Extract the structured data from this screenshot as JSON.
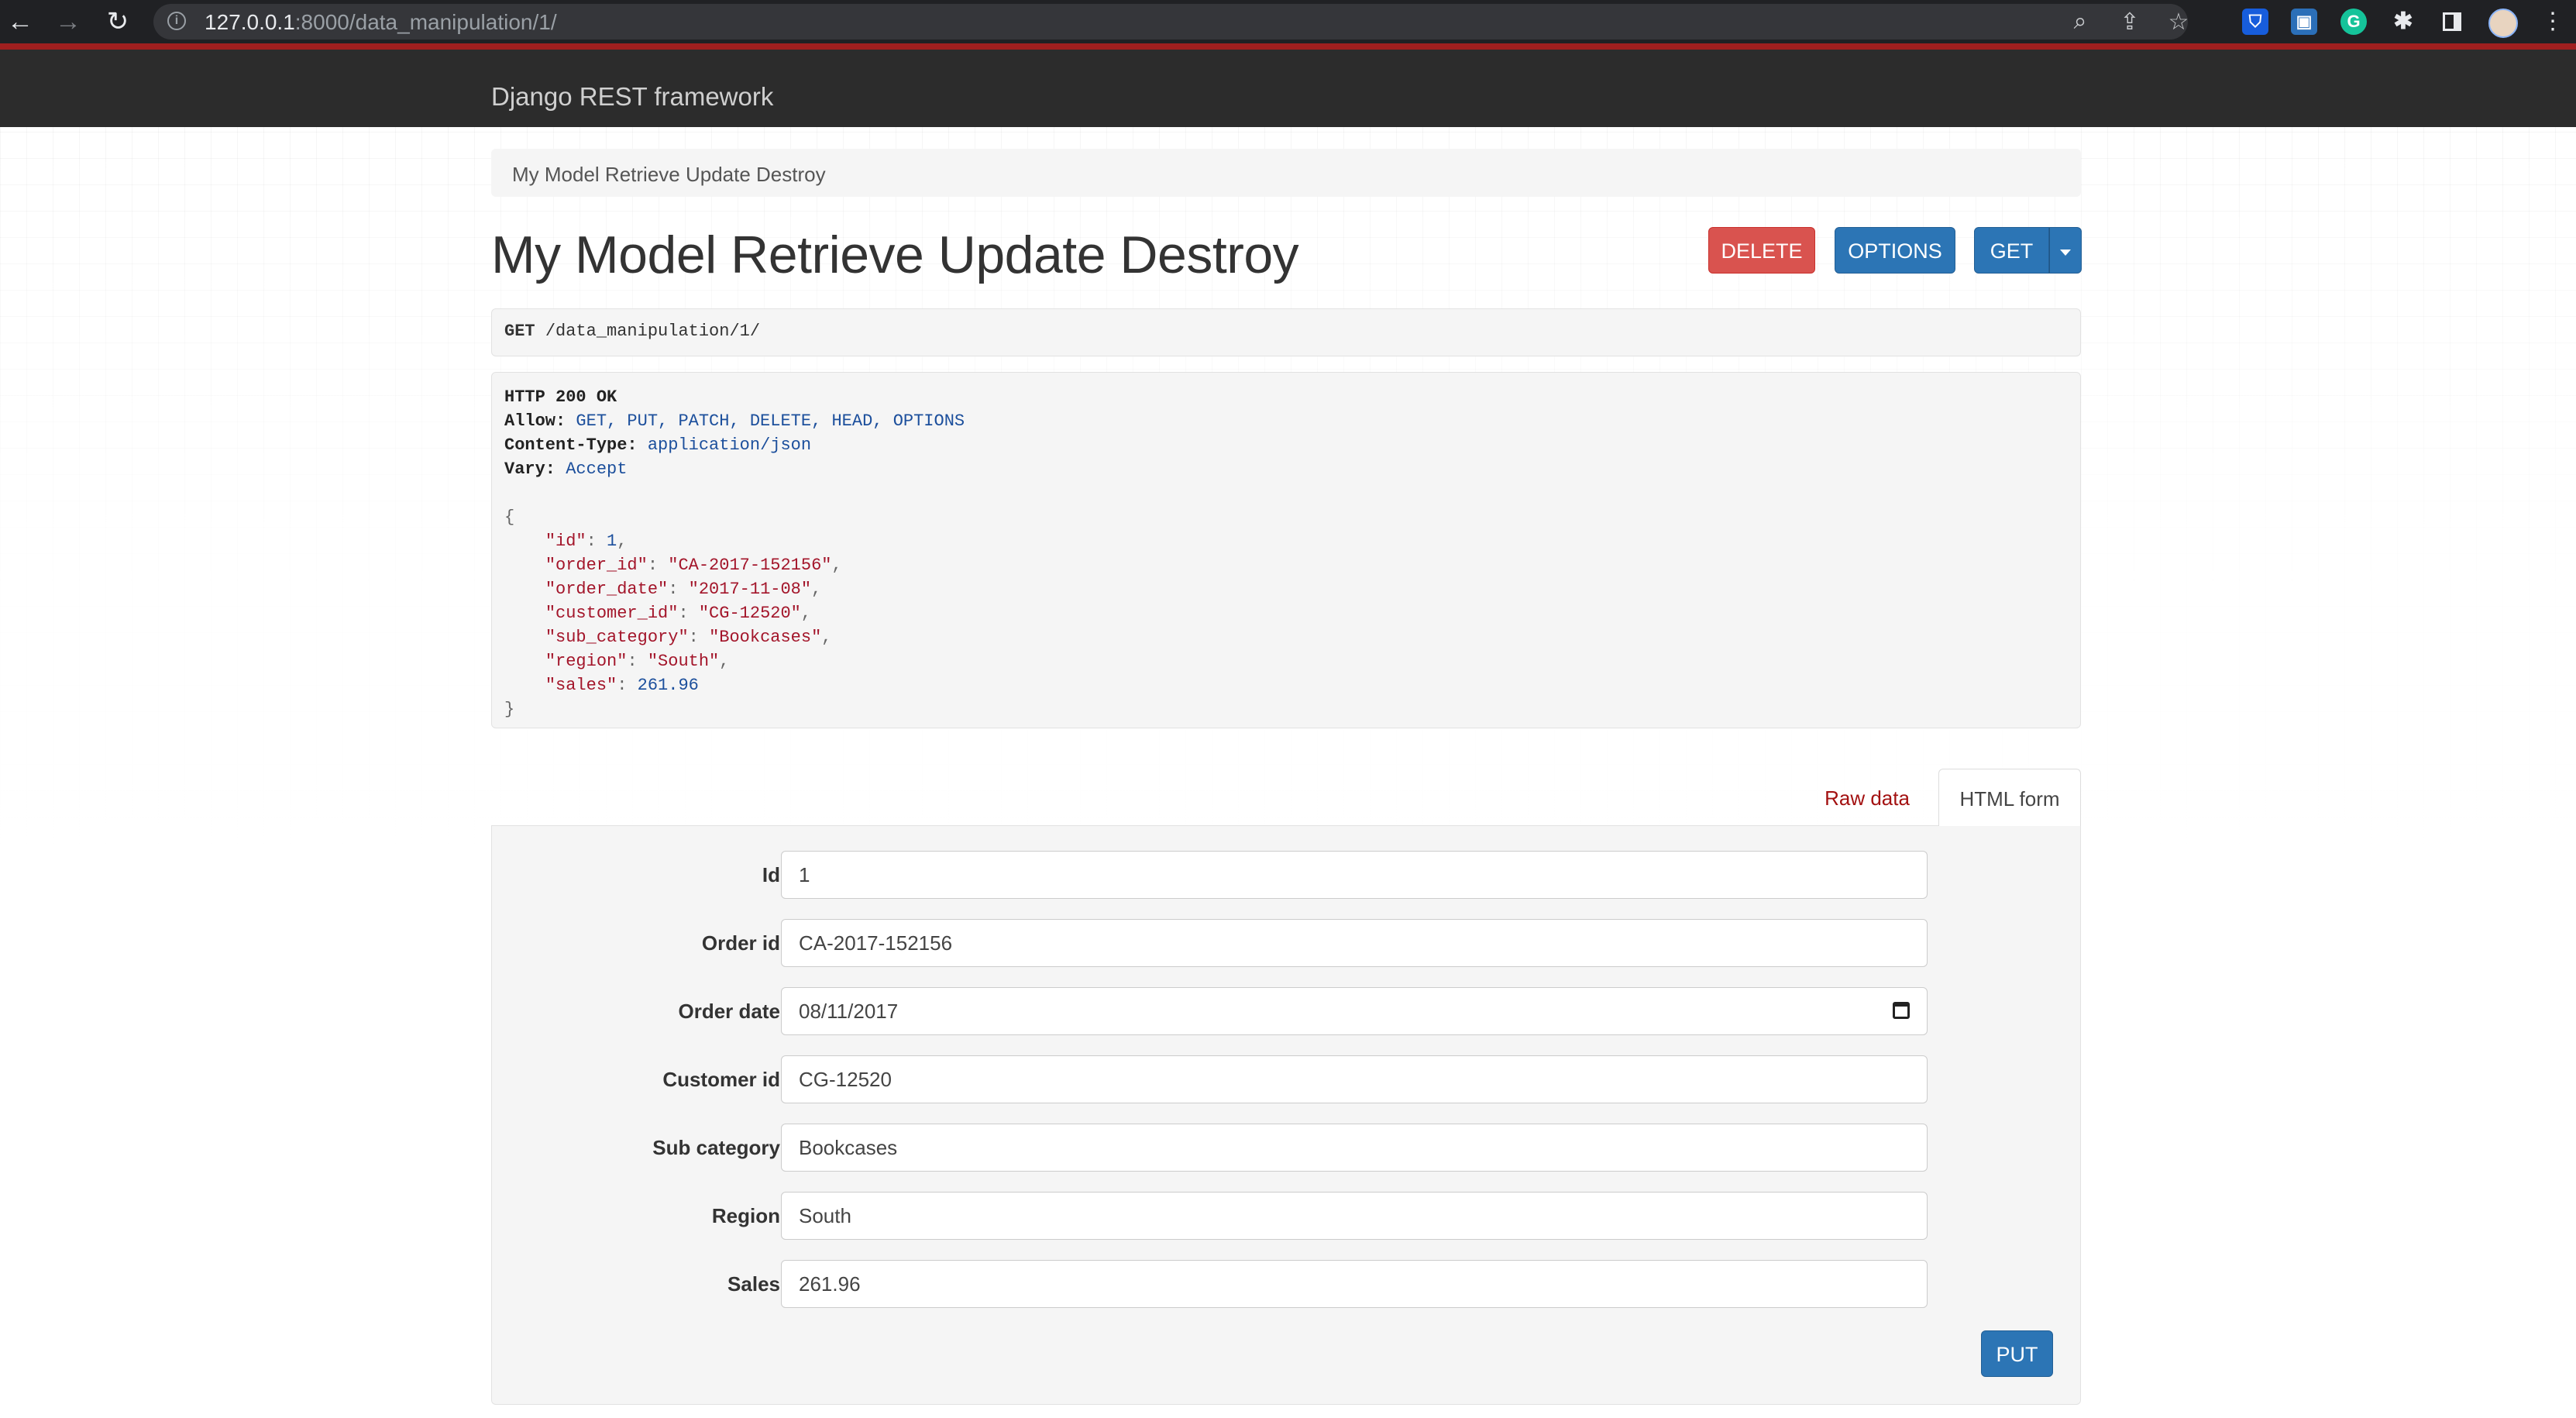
{
  "browser": {
    "url_host": "127.0.0.1",
    "url_rest": ":8000/data_manipulation/1/"
  },
  "navbar": {
    "brand": "Django REST framework"
  },
  "breadcrumb": {
    "current": "My Model Retrieve Update Destroy"
  },
  "page": {
    "title": "My Model Retrieve Update Destroy",
    "buttons": {
      "delete": "DELETE",
      "options": "OPTIONS",
      "get": "GET"
    }
  },
  "request": {
    "method": "GET",
    "path": "/data_manipulation/1/"
  },
  "response": {
    "status": "HTTP 200 OK",
    "headers": [
      {
        "name": "Allow:",
        "value": "GET, PUT, PATCH, DELETE, HEAD, OPTIONS"
      },
      {
        "name": "Content-Type:",
        "value": "application/json"
      },
      {
        "name": "Vary:",
        "value": "Accept"
      }
    ],
    "open_brace": "{",
    "close_brace": "}",
    "body": [
      {
        "key": "\"id\"",
        "value": "1",
        "type": "number",
        "comma": ","
      },
      {
        "key": "\"order_id\"",
        "value": "\"CA-2017-152156\"",
        "type": "string",
        "comma": ","
      },
      {
        "key": "\"order_date\"",
        "value": "\"2017-11-08\"",
        "type": "string",
        "comma": ","
      },
      {
        "key": "\"customer_id\"",
        "value": "\"CG-12520\"",
        "type": "string",
        "comma": ","
      },
      {
        "key": "\"sub_category\"",
        "value": "\"Bookcases\"",
        "type": "string",
        "comma": ","
      },
      {
        "key": "\"region\"",
        "value": "\"South\"",
        "type": "string",
        "comma": ","
      },
      {
        "key": "\"sales\"",
        "value": "261.96",
        "type": "number",
        "comma": ""
      }
    ]
  },
  "tabs": {
    "raw": "Raw data",
    "html": "HTML form"
  },
  "form": {
    "fields": [
      {
        "label": "Id",
        "value": "1"
      },
      {
        "label": "Order id",
        "value": "CA-2017-152156"
      },
      {
        "label": "Order date",
        "value": "08/11/2017"
      },
      {
        "label": "Customer id",
        "value": "CG-12520"
      },
      {
        "label": "Sub category",
        "value": "Bookcases"
      },
      {
        "label": "Region",
        "value": "South"
      },
      {
        "label": "Sales",
        "value": "261.96"
      }
    ],
    "submit": "PUT"
  },
  "colors": {
    "danger": "#d9534f",
    "primary": "#2c75b5",
    "navbar": "#2c2c2c",
    "accent_stripe": "#a01f1f"
  }
}
